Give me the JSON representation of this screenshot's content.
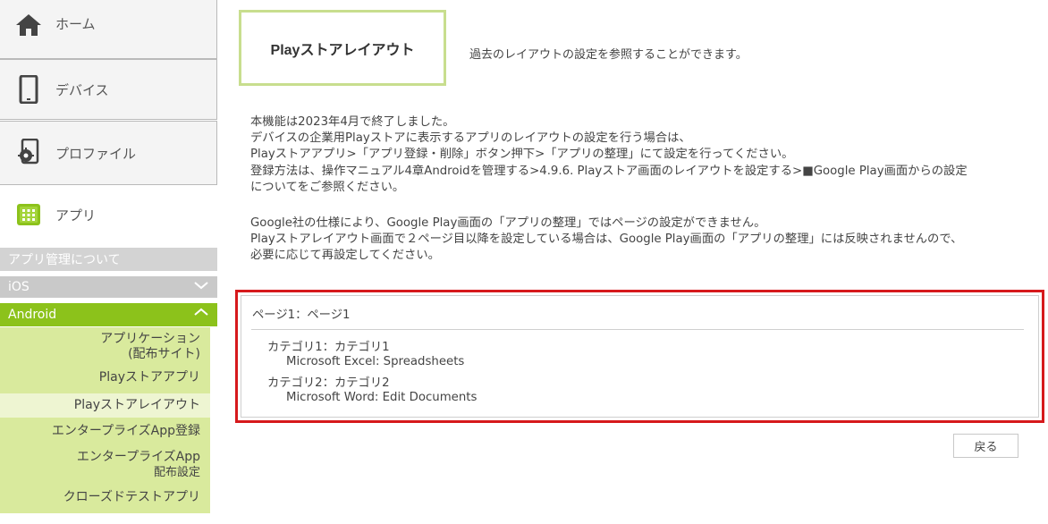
{
  "sidebar": {
    "home_label": "ホーム",
    "device_label": "デバイス",
    "profile_label": "プロファイル",
    "app_label": "アプリ",
    "about_label": "アプリ管理について",
    "ios_label": "iOS",
    "android_label": "Android",
    "android_items": [
      {
        "line1": "アプリケーション",
        "line2": "(配布サイト)"
      },
      {
        "line1": "Playストアアプリ"
      },
      {
        "line1": "Playストアレイアウト",
        "active": true
      },
      {
        "line1": "エンタープライズApp登録"
      },
      {
        "line1": "エンタープライズApp",
        "line2": "配布設定"
      },
      {
        "line1": "クローズドテストアプリ"
      }
    ],
    "icons": {
      "home": "home-icon",
      "device": "smartphone-icon",
      "profile": "profile-settings-icon",
      "app": "apps-grid-icon",
      "ios_chevron": "chevron-down-icon",
      "android_chevron": "chevron-up-icon"
    }
  },
  "header": {
    "title": "Playストアレイアウト",
    "description": "過去のレイアウトの設定を参照することができます。"
  },
  "notice": {
    "lines": [
      "本機能は2023年4月で終了しました。",
      "デバイスの企業用Playストアに表示するアプリのレイアウトの設定を行う場合は、",
      "Playストアアプリ>「アプリ登録・削除」ボタン押下>「アプリの整理」にて設定を行ってください。",
      "登録方法は、操作マニュアル4章Androidを管理する>4.9.6. Playストア画面のレイアウトを設定する>■Google Play画面からの設定",
      "についてをご参照ください。"
    ],
    "lines2": [
      "Google社の仕様により、Google Play画面の「アプリの整理」ではページの設定ができません。",
      "Playストアレイアウト画面で２ページ目以降を設定している場合は、Google Play画面の「アプリの整理」には反映されませんので、",
      "必要に応じて再設定してください。"
    ]
  },
  "layout": {
    "page_label": "ページ1：ページ1",
    "categories": [
      {
        "label": "カテゴリ1：カテゴリ1",
        "app": "Microsoft Excel: Spreadsheets"
      },
      {
        "label": "カテゴリ2：カテゴリ2",
        "app": "Microsoft Word: Edit Documents"
      }
    ]
  },
  "actions": {
    "back_label": "戻る"
  },
  "colors": {
    "accent_green": "#8cc21b",
    "submenu_green": "#d9ea9d",
    "title_border": "#c8de8e",
    "highlight_red": "#d6191c"
  }
}
